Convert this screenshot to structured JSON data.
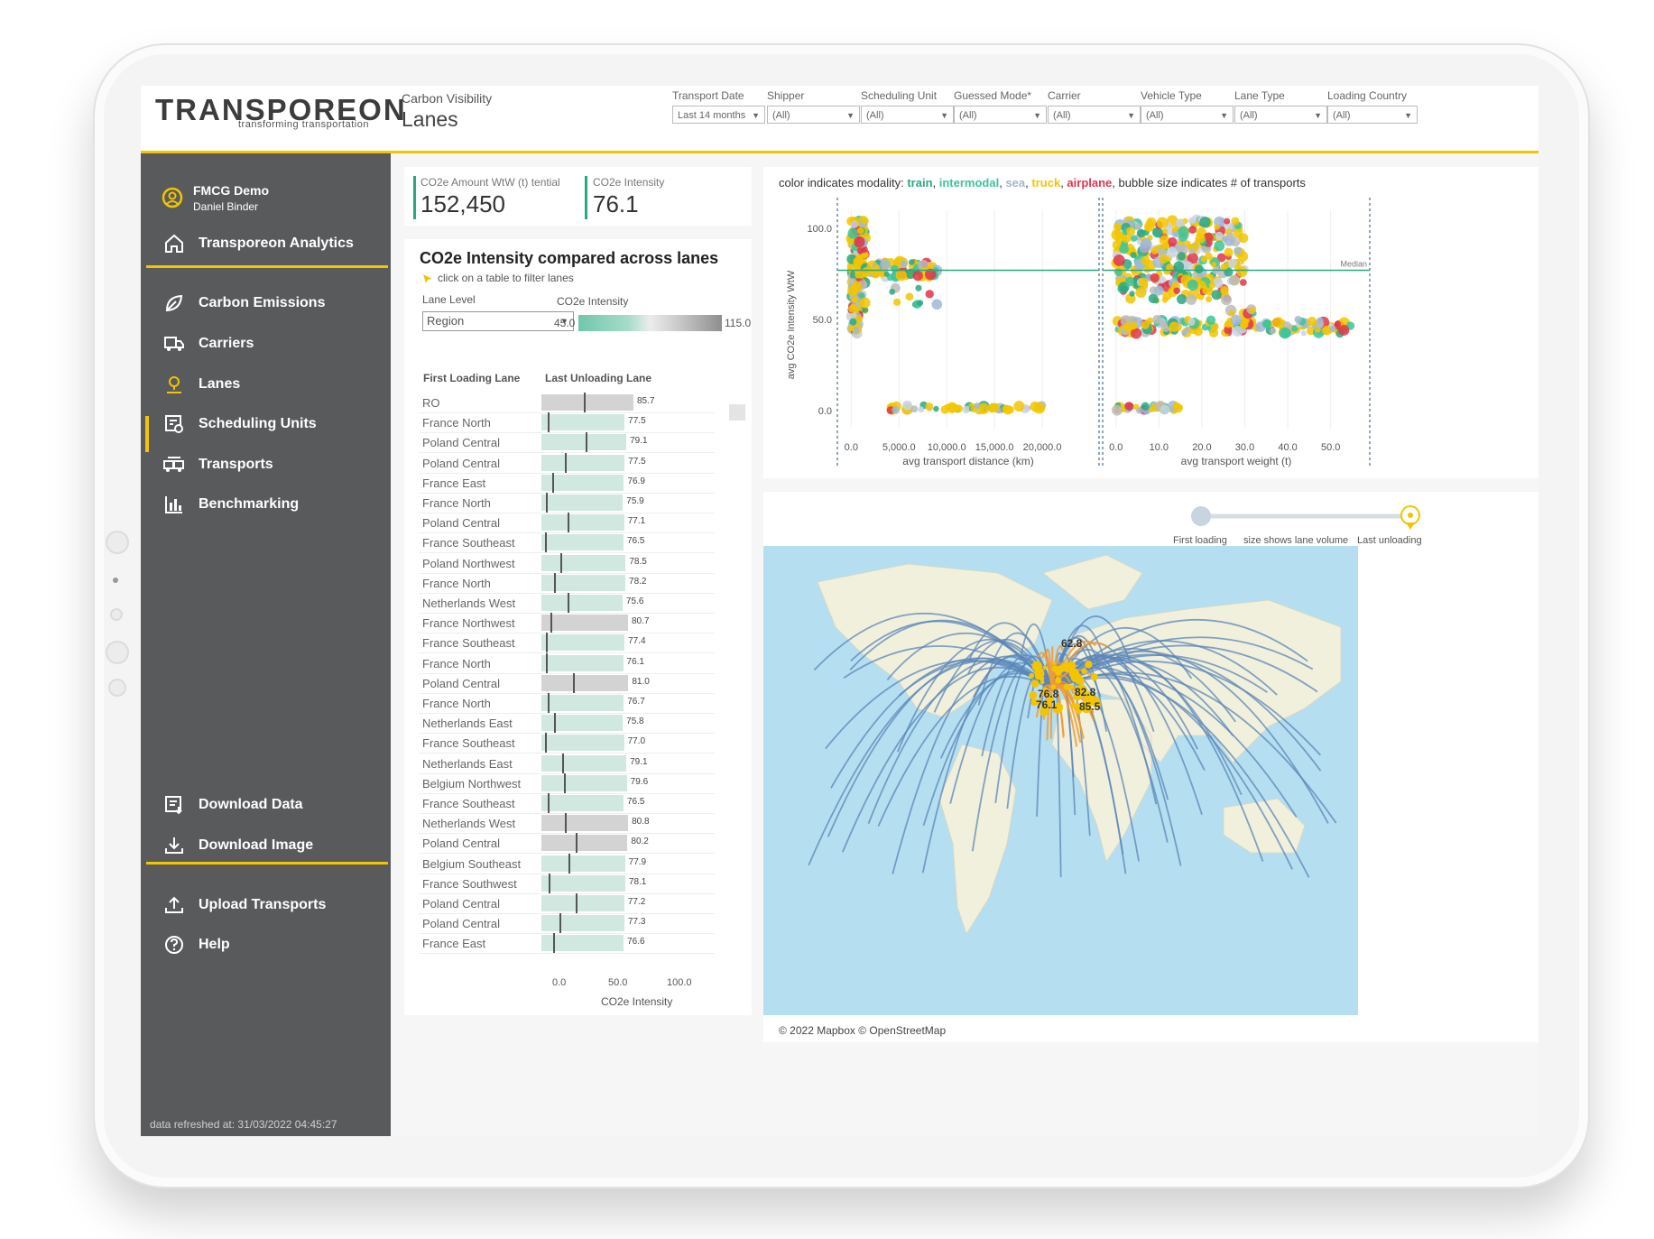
{
  "header": {
    "logo_main": "TRANSPOREON",
    "logo_sub": "transforming transportation",
    "subtitle": "Carbon Visibility",
    "title": "Lanes"
  },
  "filters": [
    {
      "label": "Transport Date",
      "value": "Last 14 months"
    },
    {
      "label": "Shipper",
      "value": "(All)"
    },
    {
      "label": "Scheduling Unit",
      "value": "(All)"
    },
    {
      "label": "Guessed Mode*",
      "value": "(All)"
    },
    {
      "label": "Carrier",
      "value": "(All)"
    },
    {
      "label": "Vehicle Type",
      "value": "(All)"
    },
    {
      "label": "Lane Type",
      "value": "(All)"
    },
    {
      "label": "Loading Country",
      "value": "(All)"
    }
  ],
  "sidebar": {
    "user_org": "FMCG Demo",
    "user_name": "Daniel Binder",
    "items": [
      {
        "label": "Transporeon Analytics",
        "icon": "home-icon"
      },
      {
        "label": "Carbon Emissions",
        "icon": "leaf-icon"
      },
      {
        "label": "Carriers",
        "icon": "truck-icon"
      },
      {
        "label": "Lanes",
        "icon": "location-pin-icon",
        "active": true
      },
      {
        "label": "Scheduling Units",
        "icon": "schedule-icon"
      },
      {
        "label": "Transports",
        "icon": "transports-icon"
      },
      {
        "label": "Benchmarking",
        "icon": "bar-chart-icon"
      },
      {
        "label": "Download Data",
        "icon": "download-data-icon"
      },
      {
        "label": "Download Image",
        "icon": "download-icon"
      },
      {
        "label": "Upload Transports",
        "icon": "upload-icon"
      },
      {
        "label": "Help",
        "icon": "help-icon"
      }
    ],
    "footer": "data refreshed at: 31/03/2022 04:45:27"
  },
  "kpis": {
    "amount_label": "CO2e Amount WtW (t)",
    "amount_label_tail": "tential",
    "amount_value": "152,450",
    "intensity_label": "CO2e Intensity",
    "intensity_value": "76.1"
  },
  "lanes_panel": {
    "title": "CO2e Intensity compared across lanes",
    "hint": "click on a table to filter lanes",
    "lane_level_label": "Lane Level",
    "lane_level_value": "Region",
    "intensity_legend_label": "CO2e Intensity",
    "legend_min": "45.0",
    "legend_max": "115.0",
    "col_first": "First Loading Lane",
    "col_last": "Last Unloading Lane",
    "axis_label": "CO2e Intensity",
    "axis_ticks": [
      "0.0",
      "50.0",
      "100.0"
    ]
  },
  "chart_data": [
    {
      "type": "bar",
      "title": "CO2e Intensity compared across lanes",
      "xlabel": "CO2e Intensity",
      "xlim": [
        0,
        100
      ],
      "categories": [
        "RO",
        "France North",
        "Poland Central",
        "Poland Central",
        "France East",
        "France North",
        "Poland Central",
        "France Southeast",
        "Poland Northwest",
        "France North",
        "Netherlands West",
        "France Northwest",
        "France Southeast",
        "France North",
        "Poland Central",
        "France North",
        "Netherlands East",
        "France Southeast",
        "Netherlands East",
        "Belgium Northwest",
        "France Southeast",
        "Netherlands West",
        "Poland Central",
        "Belgium Southeast",
        "France Southwest",
        "Poland Central",
        "Poland Central",
        "France East"
      ],
      "values": [
        85.7,
        77.5,
        79.1,
        77.5,
        76.9,
        75.9,
        77.1,
        76.5,
        78.5,
        78.2,
        75.6,
        80.7,
        77.4,
        76.1,
        81.0,
        76.7,
        75.8,
        77.0,
        79.1,
        79.6,
        76.5,
        80.8,
        80.2,
        77.9,
        78.1,
        77.2,
        77.3,
        76.6
      ],
      "labels": [
        "85.7",
        "77.5",
        "79.1",
        "77.5",
        "76.9",
        "75.9",
        "77.1",
        "76.5",
        "78.5",
        "78.2",
        "75.6",
        "80.7",
        "77.4",
        "76.1",
        "81.0",
        "76.7",
        "75.8",
        "77.0",
        "79.1",
        "79.6",
        "76.5",
        "80.8",
        "80.2",
        "77.9",
        "78.1",
        "77.2",
        "77.3",
        "76.6"
      ],
      "reference_marks": [
        36,
        5,
        38,
        20,
        9,
        4,
        22,
        3,
        16,
        11,
        22,
        8,
        4,
        4,
        27,
        5,
        11,
        3,
        18,
        19,
        5,
        20,
        29,
        23,
        6,
        29,
        15,
        10
      ]
    },
    {
      "type": "scatter",
      "title": "color indicates modality: train, intermodal, sea, truck, airplane, bubble size indicates # of transports",
      "ylabel": "avg CO2e Intensity WtW",
      "panels": [
        {
          "xlabel": "avg transport distance (km)",
          "x_ticks": [
            "0.0",
            "5,000.0",
            "10,000.0",
            "15,000.0",
            "20,000.0"
          ],
          "xlim": [
            -500,
            25000
          ]
        },
        {
          "xlabel": "avg transport weight (t)",
          "x_ticks": [
            "0.0",
            "10.0",
            "20.0",
            "30.0",
            "40.0",
            "50.0"
          ],
          "xlim": [
            -1,
            57
          ]
        }
      ],
      "y_ticks": [
        "0.0",
        "50.0",
        "100.0"
      ],
      "ylim": [
        -10,
        110
      ],
      "median_label": "Median",
      "median": 77
    }
  ],
  "scatter_title_parts": {
    "prefix": "color indicates modality: ",
    "train": "train",
    "intermodal": "intermodal",
    "sea": "sea",
    "truck": "truck",
    "airplane": "airplane",
    "suffix": ", bubble size indicates # of transports"
  },
  "map": {
    "legend_first": "First loading",
    "legend_mid": "size shows lane volume",
    "legend_last": "Last unloading",
    "credit": "© 2022 Mapbox © OpenStreetMap",
    "labels": [
      "62.8",
      "76.8",
      "76.1",
      "82.8",
      "85.5"
    ],
    "colors": {
      "ocean": "#b5dff0",
      "land": "#f1f0dc",
      "arc_blue": "#5b86b8",
      "arc_orange": "#f29a2e",
      "hub": "#f2c500"
    }
  },
  "colors": {
    "accent": "#f2c500",
    "sidebar": "#595a5c",
    "teal": "#2aa882",
    "bar_low": "#d1e8e0",
    "bar_high": "#d3d3d3"
  }
}
